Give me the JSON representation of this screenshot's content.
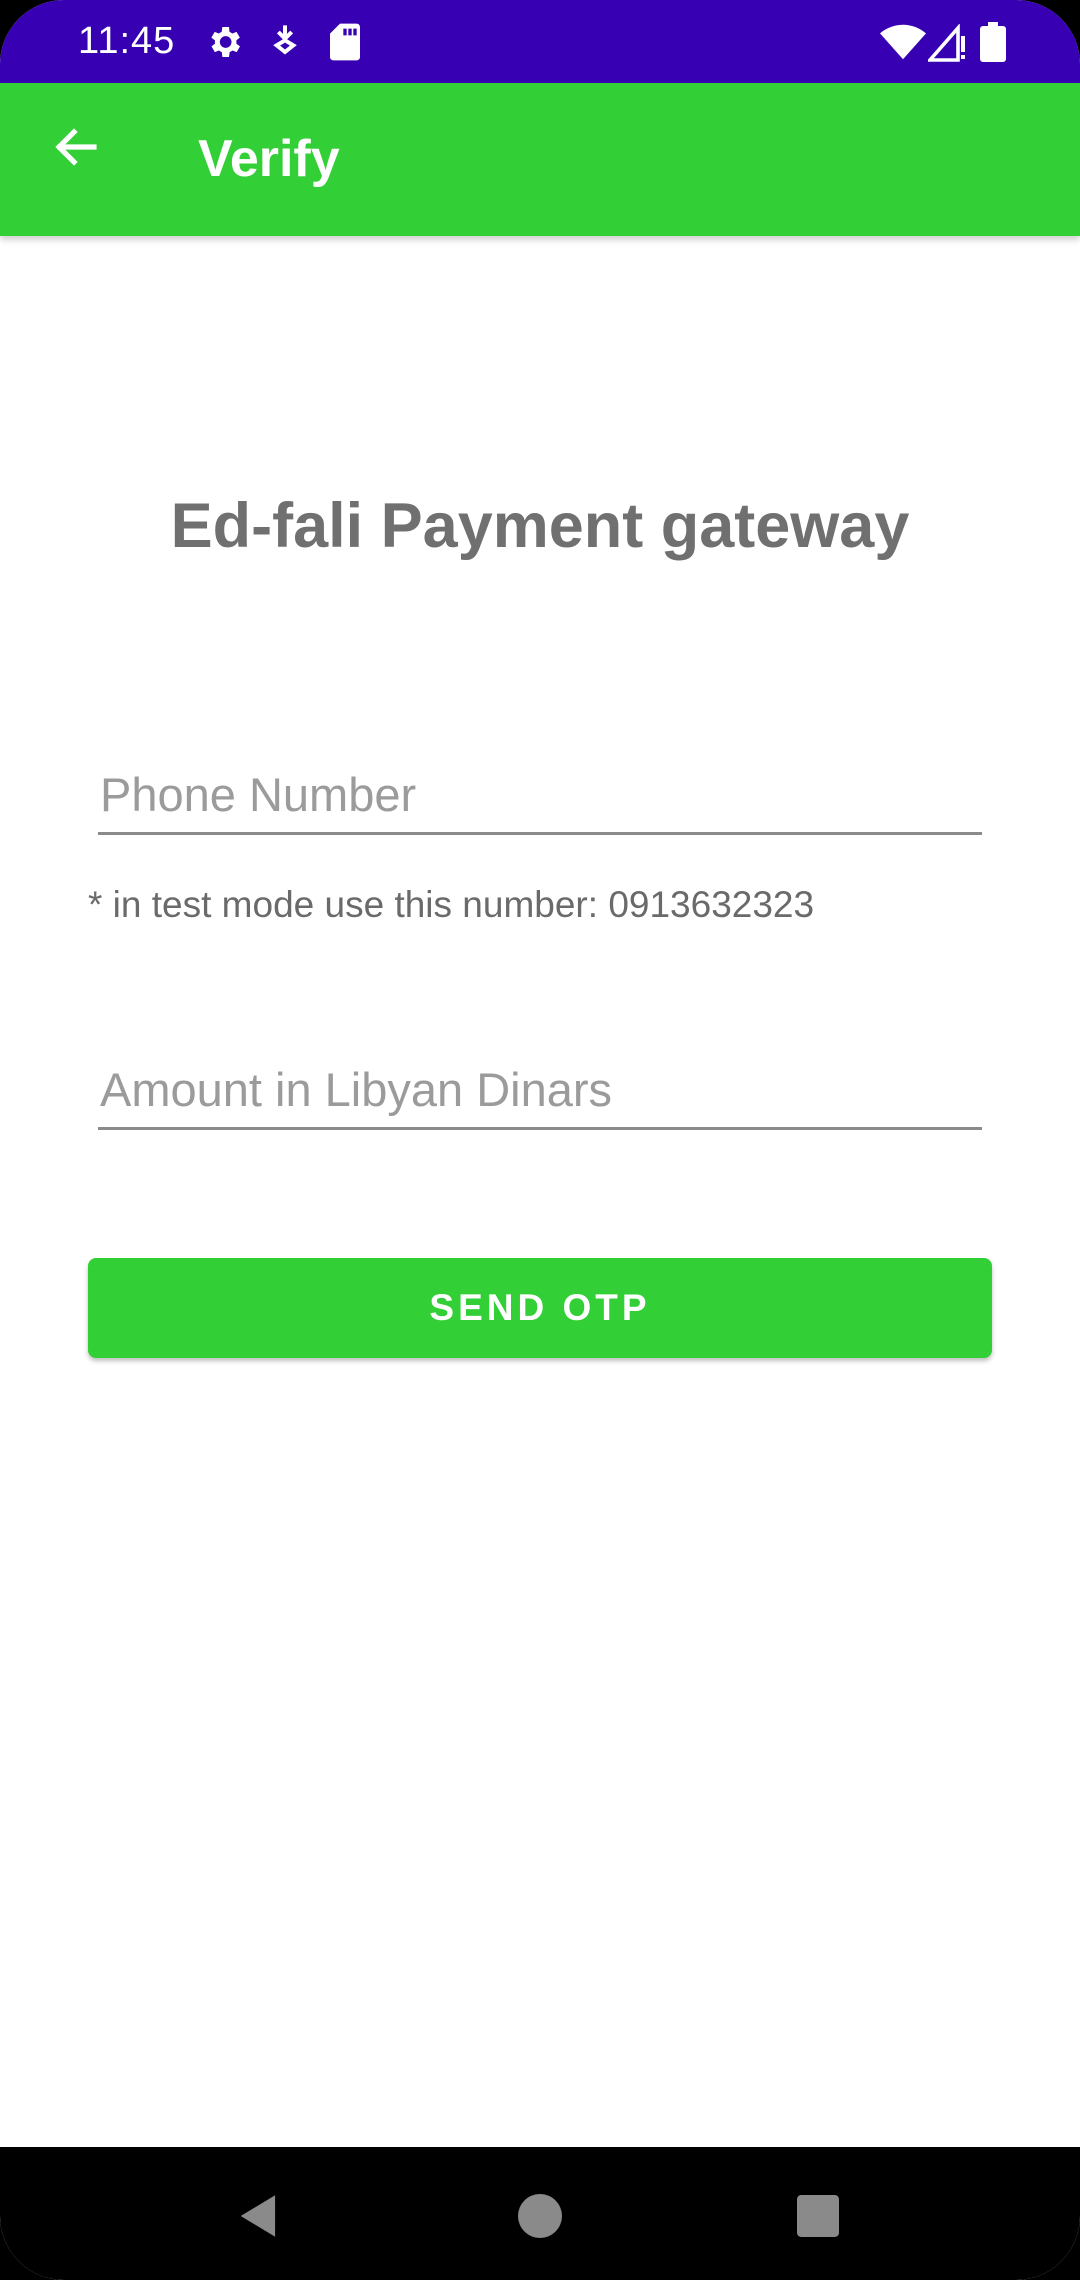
{
  "status_bar": {
    "time": "11:45",
    "left_icons": [
      "gear-icon",
      "download-icon",
      "sd-card-icon"
    ],
    "right_icons": [
      "wifi-icon",
      "cell-signal-icon",
      "battery-icon"
    ],
    "background": "#3700B3"
  },
  "app_bar": {
    "title": "Verify",
    "back_icon": "arrow-back-icon",
    "background": "#33CF36"
  },
  "main": {
    "heading": "Ed-fali Payment gateway",
    "phone_field": {
      "placeholder": "Phone Number",
      "value": ""
    },
    "hint": "* in test mode use this number: 0913632323",
    "amount_field": {
      "placeholder": "Amount in Libyan Dinars",
      "value": ""
    },
    "send_button_label": "SEND OTP",
    "accent_color": "#33CF36"
  },
  "nav_bar": {
    "buttons": [
      "back-triangle-icon",
      "home-circle-icon",
      "recents-square-icon"
    ]
  }
}
